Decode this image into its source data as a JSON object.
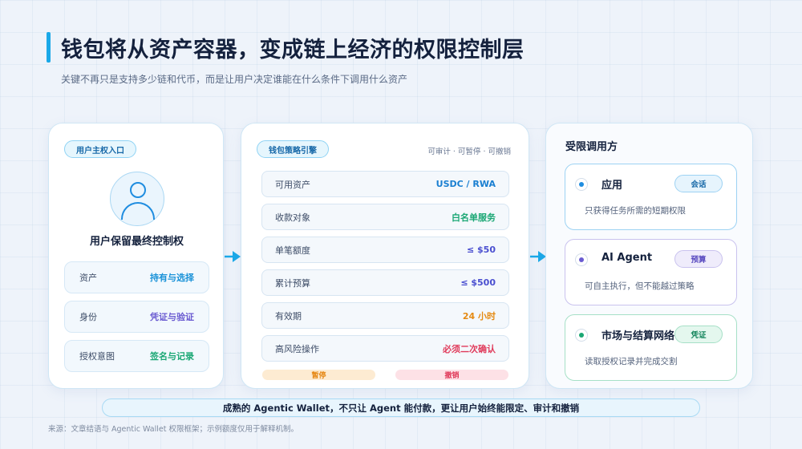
{
  "title": "钱包将从资产容器，变成链上经济的权限控制层",
  "subtitle": "关键不再只是支持多少链和代币，而是让用户决定谁能在什么条件下调用什么资产",
  "left_panel": {
    "pill": "用户主权入口",
    "caption": "用户保留最终控制权",
    "rows": [
      {
        "key": "资产",
        "value": "持有与选择",
        "color": "#1a92d8"
      },
      {
        "key": "身份",
        "value": "凭证与验证",
        "color": "#6a5bd1"
      },
      {
        "key": "授权意图",
        "value": "签名与记录",
        "color": "#1aa774"
      }
    ]
  },
  "middle_panel": {
    "pill": "钱包策略引擎",
    "note": "可审计 · 可暂停 · 可撤销",
    "rows": [
      {
        "key": "可用资产",
        "value": "USDC / RWA",
        "color": "#1a7fd1"
      },
      {
        "key": "收款对象",
        "value": "白名单服务",
        "color": "#1aa774"
      },
      {
        "key": "单笔额度",
        "value": "≤ $50",
        "color": "#4a4fd0"
      },
      {
        "key": "累计预算",
        "value": "≤ $500",
        "color": "#4a4fd0"
      },
      {
        "key": "有效期",
        "value": "24 小时",
        "color": "#e58a12"
      },
      {
        "key": "高风险操作",
        "value": "必须二次确认",
        "color": "#e03a5a"
      }
    ],
    "actions": [
      {
        "label": "暂停",
        "color": "#e5850f",
        "bg": "#fdebd2"
      },
      {
        "label": "撤销",
        "color": "#e03a5a",
        "bg": "#fde1e6"
      }
    ]
  },
  "right_panel": {
    "title": "受限调用方",
    "callers": [
      {
        "name": "应用",
        "tag": "会话",
        "desc": "只获得任务所需的短期权限",
        "accent": "#1f8de0",
        "border": "#9dd2f3",
        "tag_bg": "#e6f4fd",
        "tag_color": "#1668a8"
      },
      {
        "name": "AI Agent",
        "tag": "预算",
        "desc": "可自主执行，但不能越过策略",
        "accent": "#6a5bd1",
        "border": "#c9c2ee",
        "tag_bg": "#efecfb",
        "tag_color": "#5a4bc0"
      },
      {
        "name": "市场与结算网络",
        "tag": "凭证",
        "desc": "读取授权记录并完成交割",
        "accent": "#1aa774",
        "border": "#a6e0c7",
        "tag_bg": "#e4f7ee",
        "tag_color": "#14855c"
      }
    ]
  },
  "banner": "成熟的 Agentic Wallet，不只让 Agent 能付款，更让用户始终能限定、审计和撤销",
  "source": "来源：文章结语与 Agentic Wallet 权限框架；示例额度仅用于解释机制。"
}
